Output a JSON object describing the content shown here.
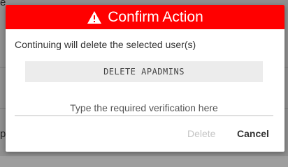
{
  "background": {
    "top_fragment": "e",
    "bottom_fragment": "p"
  },
  "dialog": {
    "title": "Confirm Action",
    "header_color": "#ff0000",
    "icon": "warning-icon",
    "message": "Continuing will delete the selected user(s)",
    "confirmation_code": "DELETE APADMINS",
    "input_value": "",
    "input_placeholder": "Type the required verification here",
    "delete_label": "Delete",
    "cancel_label": "Cancel"
  }
}
